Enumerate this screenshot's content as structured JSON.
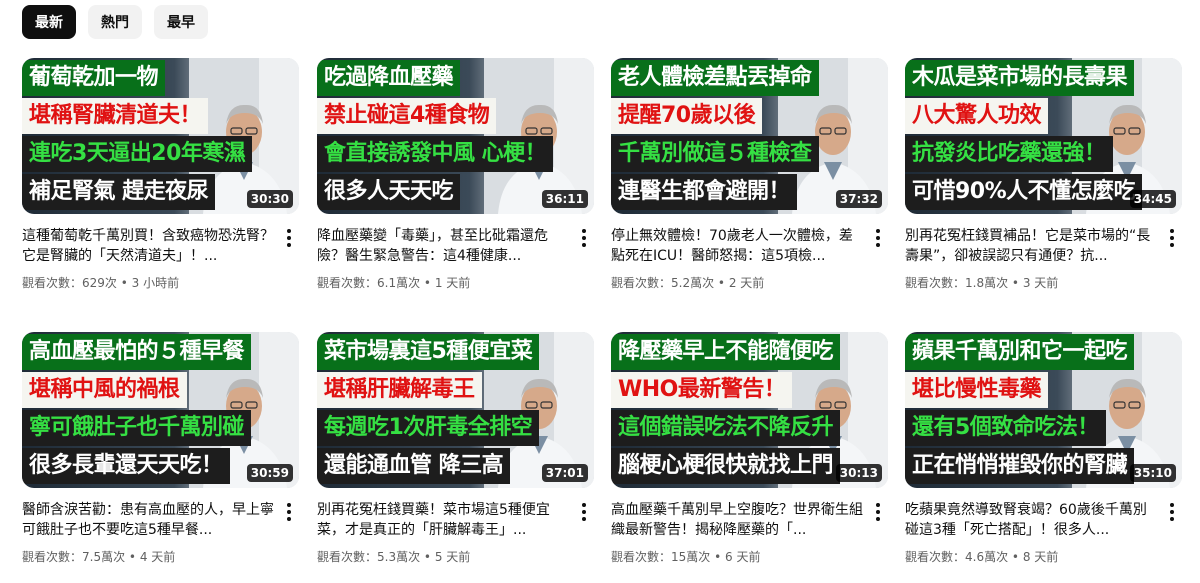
{
  "filters": [
    "最新",
    "熱門",
    "最早"
  ],
  "videos": [
    {
      "lines": [
        "葡萄乾加一物",
        "堪稱腎臟清道夫！",
        "連吃3天逼出20年寒濕",
        "補足腎氣 趕走夜尿"
      ],
      "duration": "30:30",
      "title": "這種葡萄乾千萬別買！含致癌物恐洗腎？它是腎臟的「天然清道夫」！...",
      "views": "觀看次數：629次",
      "time": "3 小時前"
    },
    {
      "lines": [
        "吃過降血壓藥",
        "禁止碰這4種食物",
        "會直接誘發中風 心梗！",
        "很多人天天吃"
      ],
      "duration": "36:11",
      "title": "降血壓藥變「毒藥」，甚至比砒霜還危險？醫生緊急警告：這4種健康...",
      "views": "觀看次數：6.1萬次",
      "time": "1 天前"
    },
    {
      "lines": [
        "老人體檢差點丟掉命",
        "提醒70歲以後",
        "千萬別做這５種檢查",
        "連醫生都會避開！"
      ],
      "duration": "37:32",
      "title": "停止無效體檢！70歲老人一次體檢，差點死在ICU！醫師怒揭：這5項檢...",
      "views": "觀看次數：5.2萬次",
      "time": "2 天前"
    },
    {
      "lines": [
        "木瓜是菜市場的長壽果",
        "八大驚人功效",
        "抗發炎比吃藥還強！",
        "可惜90%人不懂怎麼吃"
      ],
      "duration": "34:45",
      "title": "別再花冤枉錢買補品！它是菜市場的“長壽果”，卻被誤認只有通便？抗...",
      "views": "觀看次數：1.8萬次",
      "time": "3 天前"
    },
    {
      "lines": [
        "高血壓最怕的５種早餐",
        "堪稱中風的禍根",
        "寧可餓肚子也千萬別碰",
        "很多長輩還天天吃！"
      ],
      "duration": "30:59",
      "title": "醫師含淚苦勸：患有高血壓的人，早上寧可餓肚子也不要吃這5種早餐...",
      "views": "觀看次數：7.5萬次",
      "time": "4 天前"
    },
    {
      "lines": [
        "菜市場裏這5種便宜菜",
        "堪稱肝臟解毒王",
        "每週吃1次肝毒全排空",
        "還能通血管 降三高"
      ],
      "duration": "37:01",
      "title": "別再花冤枉錢買藥！菜市場這5種便宜菜，才是真正的「肝臟解毒王」...",
      "views": "觀看次數：5.3萬次",
      "time": "5 天前"
    },
    {
      "lines": [
        "降壓藥早上不能隨便吃",
        "WHO最新警告！",
        "這個錯誤吃法不降反升",
        "腦梗心梗很快就找上門"
      ],
      "duration": "30:13",
      "title": "高血壓藥千萬別早上空腹吃？世界衛生組織最新警告！揭秘降壓藥的「...",
      "views": "觀看次數：15萬次",
      "time": "6 天前"
    },
    {
      "lines": [
        "蘋果千萬別和它一起吃",
        "堪比慢性毒藥",
        "還有5個致命吃法！",
        "正在悄悄摧毀你的腎臟"
      ],
      "duration": "35:10",
      "title": "吃蘋果竟然導致腎衰竭？60歲後千萬別碰這3種「死亡搭配」！很多人...",
      "views": "觀看次數：4.6萬次",
      "time": "8 天前"
    }
  ],
  "colors": {
    "chip_active": "#0f0f0f",
    "chip_idle": "#f2f2f2",
    "headline_green": "#08701a",
    "headline_red": "#e01212",
    "headline_lime": "#35e043"
  },
  "icons": {
    "menu": "vertical-ellipsis-icon",
    "presenter": "doctor-portrait-icon"
  }
}
